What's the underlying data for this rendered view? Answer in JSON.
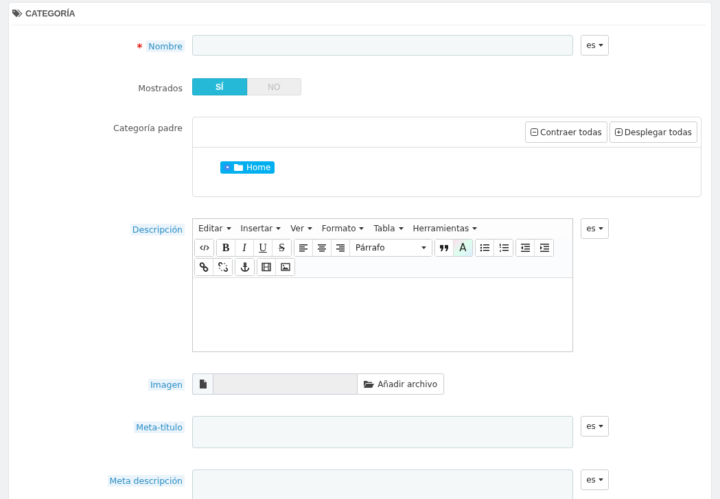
{
  "panel": {
    "title": "CATEGORÍA"
  },
  "fields": [
    {
      "kind": "text",
      "label": "Nombre",
      "required_mark": "*",
      "hint": true,
      "lang": "es"
    },
    {
      "kind": "toggle",
      "label": "Mostrados",
      "hint": false,
      "options": [
        {
          "label": "SÍ",
          "selected": true
        },
        {
          "label": "NO",
          "selected": false
        }
      ]
    },
    {
      "kind": "tree",
      "label": "Categoría padre",
      "hint": false,
      "buttons": [
        {
          "kind": "collapse",
          "label": "Contraer todas"
        },
        {
          "kind": "expand",
          "label": "Desplegar todas"
        }
      ],
      "nodes": [
        {
          "label": "Home",
          "selected": true
        }
      ]
    },
    {
      "kind": "editor",
      "label": "Descripción",
      "hint": true,
      "lang": "es",
      "menus": [
        "Editar",
        "Insertar",
        "Ver",
        "Formato",
        "Tabla",
        "Herramientas"
      ],
      "toolbar": [
        [
          [
            {
              "kind": "code"
            }
          ],
          [
            {
              "kind": "bold",
              "label": "B"
            },
            {
              "kind": "italic",
              "label": "I"
            },
            {
              "kind": "underline",
              "label": "U"
            },
            {
              "kind": "strike",
              "label": "S"
            }
          ],
          [
            {
              "kind": "align-left"
            },
            {
              "kind": "align-center"
            },
            {
              "kind": "align-right"
            },
            {
              "kind": "format",
              "label": "Párrafo"
            }
          ],
          [
            {
              "kind": "quote"
            },
            {
              "kind": "text-color",
              "label": "A"
            }
          ],
          [
            {
              "kind": "bullet-list"
            },
            {
              "kind": "number-list"
            }
          ],
          [
            {
              "kind": "outdent"
            },
            {
              "kind": "indent"
            }
          ]
        ],
        [
          [
            {
              "kind": "link"
            },
            {
              "kind": "unlink"
            }
          ],
          [
            {
              "kind": "anchor"
            }
          ],
          [
            {
              "kind": "video"
            },
            {
              "kind": "image"
            }
          ]
        ]
      ]
    },
    {
      "kind": "file",
      "label": "Imagen",
      "hint": true,
      "button": "Añadir archivo"
    },
    {
      "kind": "textarea",
      "label": "Meta-título",
      "hint": true,
      "lang": "es"
    },
    {
      "kind": "textarea",
      "label": "Meta descripción",
      "hint": true,
      "lang": "es"
    }
  ]
}
